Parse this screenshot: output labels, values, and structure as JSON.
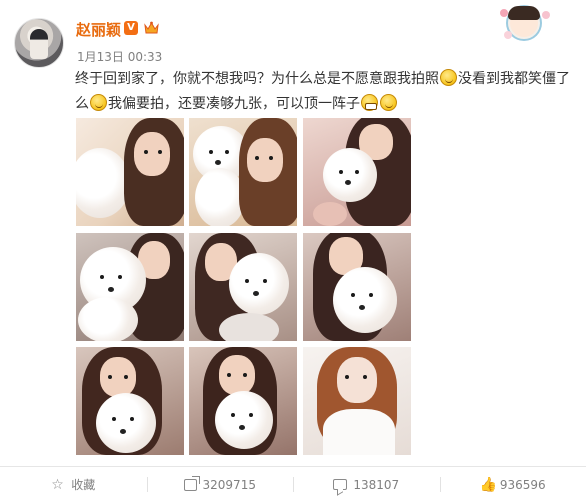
{
  "post": {
    "author": "赵丽颖",
    "verified_badge": "V",
    "timestamp": "1月13日 00:33",
    "text_part1": "终于回到家了，你就不想我吗？为什么总是不愿意跟我拍照",
    "text_part2": "没看到我都笑僵了么",
    "text_part3": "我偏要拍，还要凑够九张，可以顶一阵子",
    "photo_count": 9
  },
  "footer": {
    "favorite_label": "收藏",
    "shares": "3209715",
    "comments": "138107",
    "likes": "936596"
  },
  "colors": {
    "author_name": "#e86b0f",
    "verified": "#f36e14",
    "text": "#333333",
    "meta": "#808080"
  },
  "icons": [
    "crown-icon",
    "star-icon",
    "share-icon",
    "comment-icon",
    "like-icon",
    "emoji-icon"
  ]
}
